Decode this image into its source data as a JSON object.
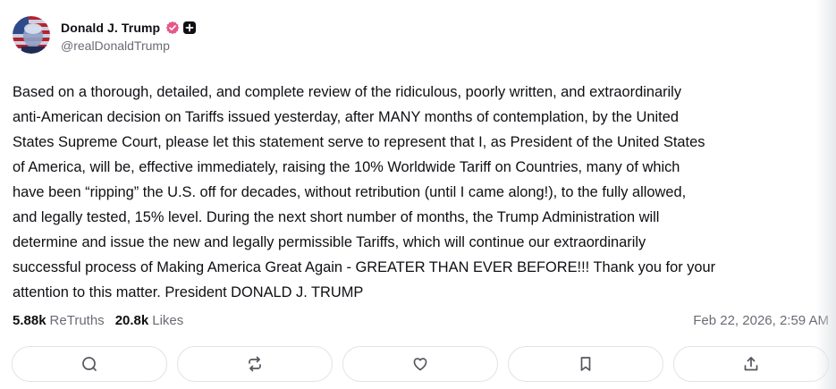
{
  "author": {
    "display_name": "Donald J. Trump",
    "handle": "@realDonaldTrump",
    "avatar_icon": "avatar-portrait-flag",
    "verified_icon": "verified-badge-icon",
    "verified_color": "#e8578a"
  },
  "post": {
    "text": "Based on a thorough, detailed, and complete review of the ridiculous, poorly written, and extraordinarily\nanti-American decision on Tariffs issued yesterday, after MANY months of contemplation, by the United\nStates Supreme Court, please let this statement serve to represent that I, as President of the United States\nof America, will be, effective immediately, raising the 10% Worldwide Tariff on Countries, many of which\nhave been “ripping” the U.S. off for decades, without retribution (until I came along!), to the fully allowed,\nand legally tested, 15% level. During the next short number of months, the Trump Administration will\ndetermine and issue the new and legally permissible Tariffs, which will continue our extraordinarily\nsuccessful process of Making America Great Again - GREATER THAN EVER BEFORE!!! Thank you for your\nattention to this matter. President DONALD J. TRUMP",
    "timestamp": "Feb 22, 2026, 2:59 AM"
  },
  "stats": {
    "retruths_count": "5.88k",
    "retruths_label": "ReTruths",
    "likes_count": "20.8k",
    "likes_label": "Likes"
  },
  "actions": [
    {
      "name": "reply",
      "icon": "comment-icon"
    },
    {
      "name": "retruth",
      "icon": "retruth-icon"
    },
    {
      "name": "like",
      "icon": "heart-icon"
    },
    {
      "name": "bookmark",
      "icon": "bookmark-icon"
    },
    {
      "name": "share",
      "icon": "share-icon"
    }
  ],
  "colors": {
    "text": "#0f0f14",
    "muted": "#6b6b75",
    "border": "#e3e3e8"
  }
}
